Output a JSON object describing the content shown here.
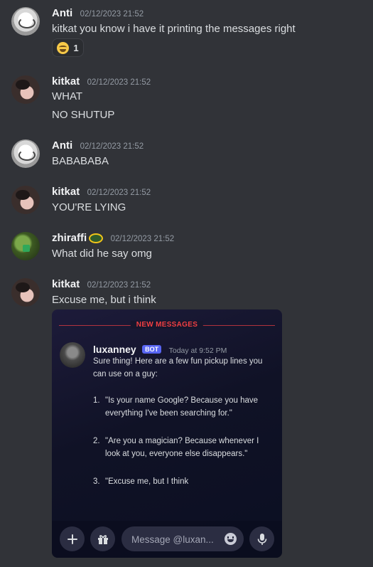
{
  "messages": [
    {
      "author": "Anti",
      "timestamp": "02/12/2023 21:52",
      "lines": [
        "kitkat you know i have it printing the messages right"
      ],
      "reaction": {
        "emoji": "laughing-crying-emoji",
        "count": "1"
      }
    },
    {
      "author": "kitkat",
      "timestamp": "02/12/2023 21:52",
      "lines": [
        "WHAT",
        "NO SHUTUP"
      ]
    },
    {
      "author": "Anti",
      "timestamp": "02/12/2023 21:52",
      "lines": [
        "BABABABA"
      ]
    },
    {
      "author": "kitkat",
      "timestamp": "02/12/2023 21:52",
      "lines": [
        "YOU'RE LYING"
      ]
    },
    {
      "author": "zhiraffi",
      "timestamp": "02/12/2023 21:52",
      "lines": [
        "What did he say omg"
      ]
    },
    {
      "author": "kitkat",
      "timestamp": "02/12/2023 21:52",
      "lines": [
        "Excuse me, but i think"
      ]
    }
  ],
  "embed": {
    "divider_label": "NEW MESSAGES",
    "bot": {
      "name": "luxanney",
      "badge": "BOT",
      "timestamp": "Today at 9:52 PM",
      "intro": "Sure thing! Here are a few fun pickup lines you can use on a guy:",
      "items": [
        {
          "num": "1.",
          "text": "\"Is your name Google? Because you have everything I've been searching for.\""
        },
        {
          "num": "2.",
          "text": "\"Are you a magician? Because whenever I look at you, everyone else disappears.\""
        },
        {
          "num": "3.",
          "text": "\"Excuse me, but I think"
        }
      ]
    },
    "composer": {
      "placeholder": "Message @luxan..."
    }
  }
}
